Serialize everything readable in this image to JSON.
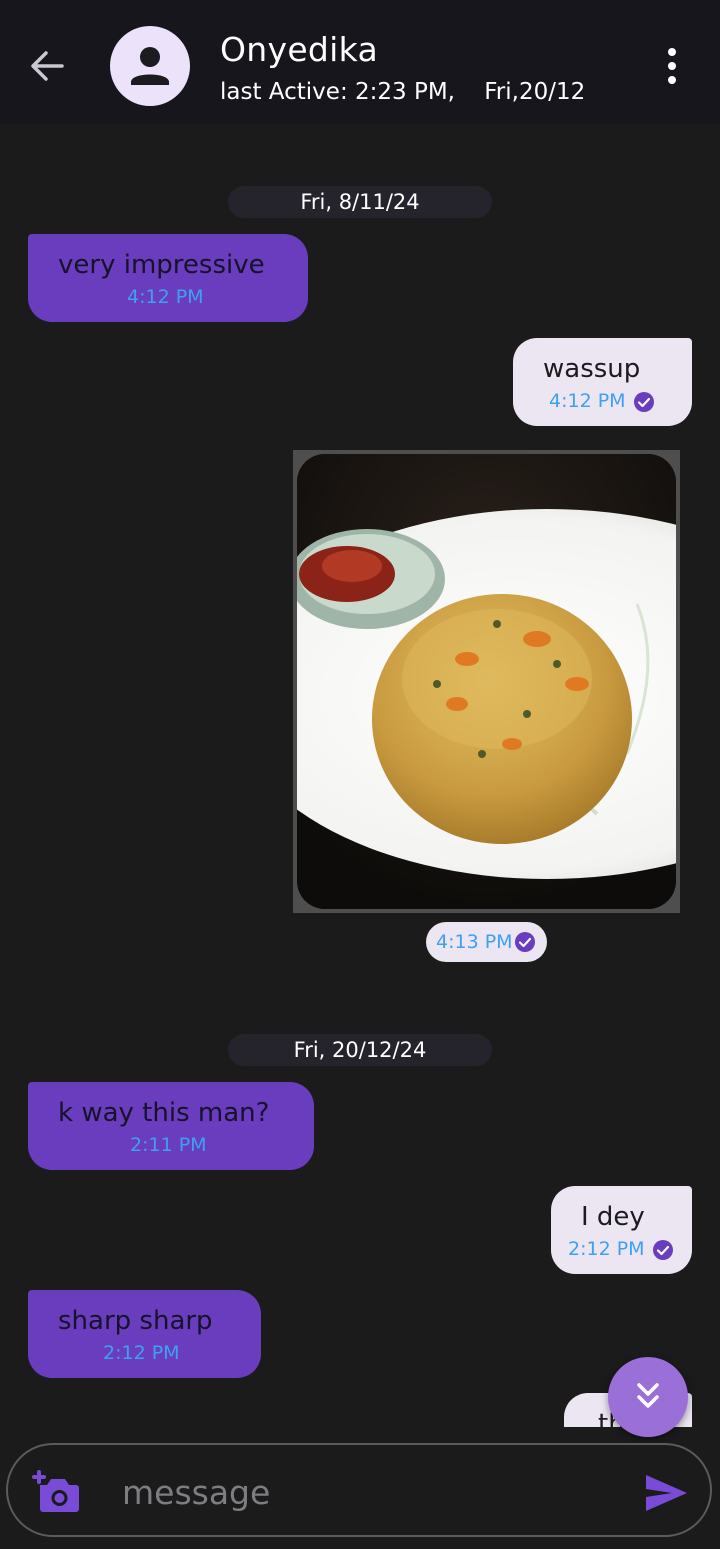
{
  "header": {
    "contact_name": "Onyedika",
    "last_active": "last Active: 2:23 PM,    Fri,20/12",
    "back_icon": "arrow-left-icon",
    "avatar_icon": "person-icon",
    "menu_icon": "more-vert-icon"
  },
  "dates": [
    "Fri, 8/11/24",
    "Fri, 20/12/24"
  ],
  "messages": [
    {
      "direction": "incoming",
      "text": "very impressive",
      "time": "4:12 PM"
    },
    {
      "direction": "outgoing",
      "text": "wassup",
      "time": "4:12 PM",
      "read": true
    },
    {
      "direction": "outgoing",
      "type": "image",
      "time": "4:13 PM",
      "read": true
    },
    {
      "direction": "incoming",
      "text": "k way this man?",
      "time": "2:11 PM"
    },
    {
      "direction": "outgoing",
      "text": "I dey",
      "time": "2:12 PM",
      "read": true
    },
    {
      "direction": "incoming",
      "text": "sharp sharp",
      "time": "2:12 PM"
    },
    {
      "direction": "outgoing",
      "text": "th",
      "partial": true
    }
  ],
  "scroll_fab": {
    "icon": "double-chevron-down-icon"
  },
  "composer": {
    "placeholder": "message",
    "camera_icon": "add-photo-icon",
    "send_icon": "send-icon"
  },
  "colors": {
    "incoming_bubble": "#6a3dbf",
    "outgoing_bubble": "#ece6f2",
    "timestamp": "#3ea0f2",
    "read_check": "#6a3dbf",
    "fab": "#9a6fd8"
  }
}
